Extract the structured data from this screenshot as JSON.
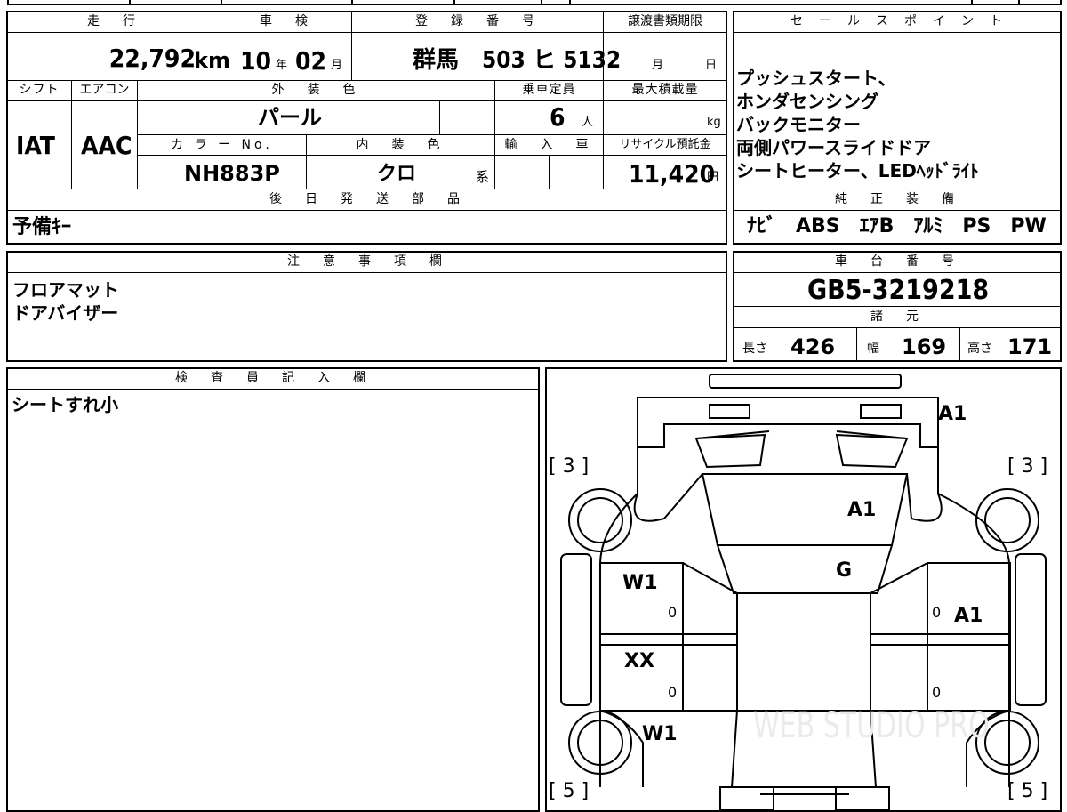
{
  "top": {
    "mileage_header": "走　行",
    "mileage_value": "22,792",
    "mileage_unit": "km",
    "inspection_header": "車　検",
    "inspection_year": "10",
    "inspection_year_unit": "年",
    "inspection_month": "02",
    "inspection_month_unit": "月",
    "registration_header": "登　録　番　号",
    "registration_value": "群馬　503 ヒ 5132",
    "transfer_header": "譲渡書類期限",
    "transfer_month_unit": "月",
    "transfer_day_unit": "日"
  },
  "row2": {
    "shift_header": "シフト",
    "shift_value": "IAT",
    "aircon_header": "エアコン",
    "aircon_value": "AAC",
    "exterior_color_header": "外　装　色",
    "exterior_color_value": "パール",
    "capacity_header": "乗車定員",
    "capacity_value": "6",
    "capacity_unit": "人",
    "max_load_header": "最大積載量",
    "max_load_unit": "kg",
    "color_no_header": "カ ラ ー No.",
    "color_no_value": "NH883P",
    "interior_color_header": "内　装　色",
    "interior_color_value": "クロ",
    "interior_color_suffix": "系",
    "import_header": "輸　入　車",
    "recycle_header": "リサイクル預託金",
    "recycle_value": "11,420",
    "recycle_unit": "円"
  },
  "later_parts": {
    "header": "後　日　発　送　部　品",
    "value": "予備ｷｰ"
  },
  "sale_points": {
    "header": "セ　ー　ル　ス　ポ　イ　ン　ト",
    "lines": [
      "プッシュスタート、",
      "ホンダセンシング",
      "バックモニター",
      "両側パワースライドドア",
      "シートヒーター、LEDﾍｯﾄﾞﾗｲﾄ"
    ]
  },
  "standard_equipment": {
    "header": "純　正　装　備",
    "value": "ﾅﾋﾞ　ABS　ｴｱB　ｱﾙﾐ　PS　PW"
  },
  "notes": {
    "header": "注　意　事　項　欄",
    "lines": [
      "フロアマット",
      "ドアバイザー"
    ]
  },
  "chassis": {
    "header": "車　台　番　号",
    "value": "GB5-3219218"
  },
  "specs": {
    "header": "諸　元",
    "length_label": "長さ",
    "length_value": "426",
    "width_label": "幅",
    "width_value": "169",
    "height_label": "高さ",
    "height_value": "171"
  },
  "inspector": {
    "header": "検　査　員　記　入　欄",
    "value": "シートすれ小"
  },
  "diagram": {
    "marks": {
      "rear_top": "A1",
      "tire_front_left": "[ 3 ]",
      "tire_front_right": "[ 3 ]",
      "tire_rear_left": "[ 5 ]",
      "tire_rear_right": "[ 5 ]",
      "hood": "A1",
      "windshield": "G",
      "left_front_door": "W1",
      "left_front_door_sub": "0",
      "left_rear_door": "XX",
      "left_rear_door_sub": "0",
      "left_rear_quarter": "W1",
      "right_front_door": "A1",
      "right_front_door_sub": "0",
      "right_rear_door_sub": "0"
    },
    "watermark": "WEB STUDIO PRO"
  }
}
